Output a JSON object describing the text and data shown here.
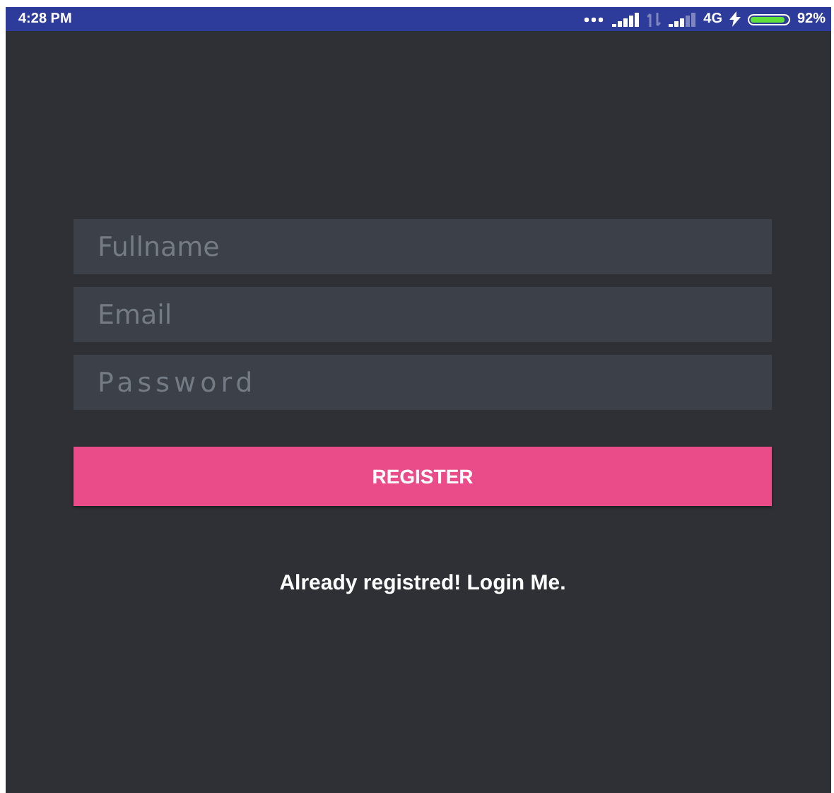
{
  "status_bar": {
    "time": "4:28 PM",
    "network": "4G",
    "battery": {
      "level": 0.92,
      "reading": "92%"
    }
  },
  "form": {
    "fields": [
      {
        "placeholder": "Fullname",
        "kind": "text"
      },
      {
        "placeholder": "Email",
        "kind": "email"
      },
      {
        "placeholder": "Password",
        "kind": "password"
      }
    ],
    "button": "REGISTER",
    "link": "Already registred! Login Me."
  }
}
